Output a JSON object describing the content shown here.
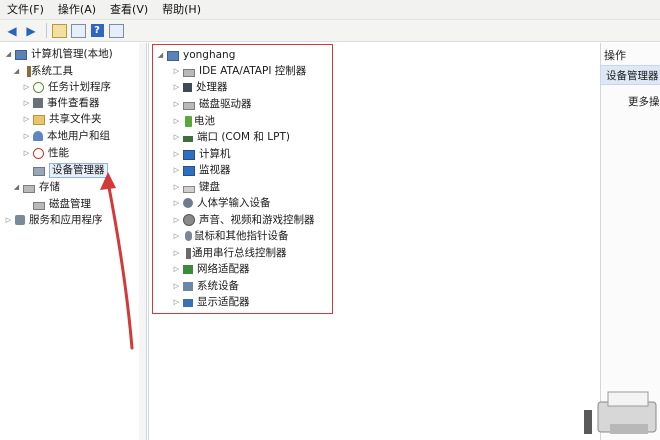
{
  "menu": {
    "items": [
      {
        "label": "文件(F)"
      },
      {
        "label": "操作(A)"
      },
      {
        "label": "查看(V)"
      },
      {
        "label": "帮助(H)"
      }
    ]
  },
  "left_tree": {
    "root": "计算机管理(本地)",
    "system_tools": "系统工具",
    "task_scheduler": "任务计划程序",
    "event_viewer": "事件查看器",
    "shared_folders": "共享文件夹",
    "local_users": "本地用户和组",
    "performance": "性能",
    "device_manager": "设备管理器",
    "storage": "存储",
    "disk_management": "磁盘管理",
    "services_apps": "服务和应用程序"
  },
  "device_tree": {
    "root": "yonghang",
    "items": [
      {
        "label": "IDE ATA/ATAPI 控制器"
      },
      {
        "label": "处理器"
      },
      {
        "label": "磁盘驱动器"
      },
      {
        "label": "电池"
      },
      {
        "label": "端口 (COM 和 LPT)"
      },
      {
        "label": "计算机"
      },
      {
        "label": "监视器"
      },
      {
        "label": "键盘"
      },
      {
        "label": "人体学输入设备"
      },
      {
        "label": "声音、视频和游戏控制器"
      },
      {
        "label": "鼠标和其他指针设备"
      },
      {
        "label": "通用串行总线控制器"
      },
      {
        "label": "网络适配器"
      },
      {
        "label": "系统设备"
      },
      {
        "label": "显示适配器"
      }
    ]
  },
  "actions": {
    "header": "操作",
    "selected": "设备管理器",
    "more": "更多操"
  },
  "colors": {
    "annotation_red": "#d23a3a",
    "selection_blue": "#dde8f6"
  }
}
